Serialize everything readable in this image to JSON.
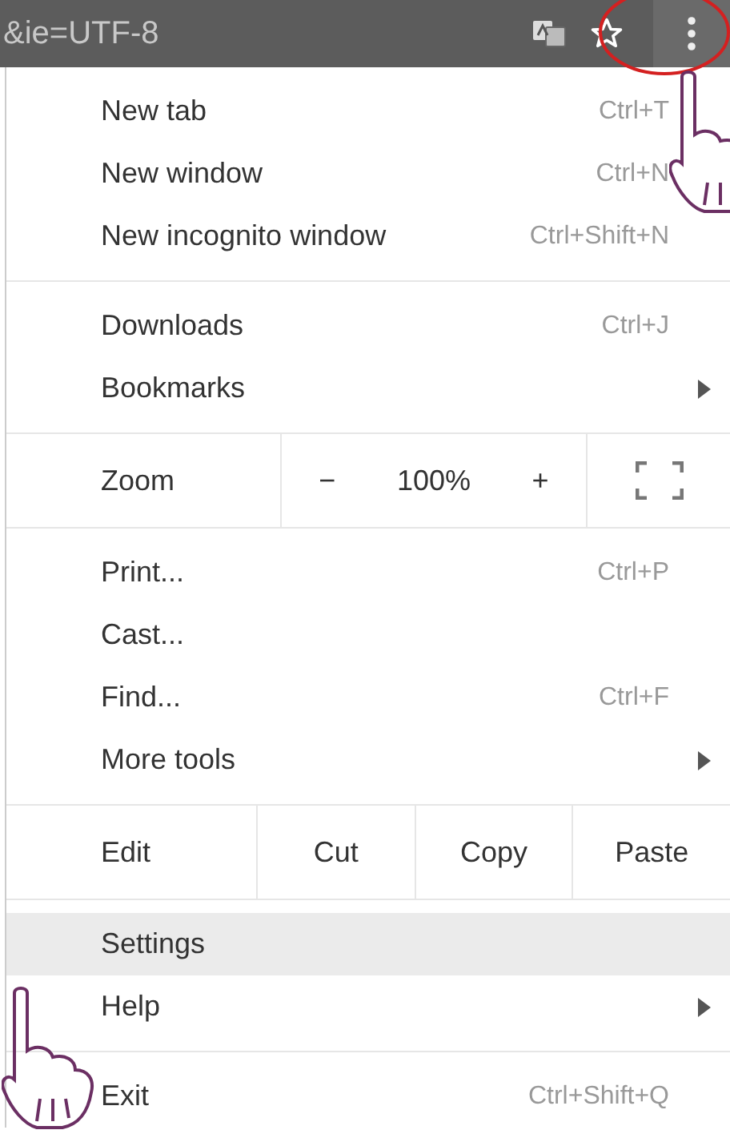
{
  "address_bar": {
    "url_text": "&ie=UTF-8"
  },
  "menu": {
    "sections": [
      {
        "kind": "items",
        "items": [
          {
            "label": "New tab",
            "shortcut": "Ctrl+T",
            "submenu": false,
            "selected": false
          },
          {
            "label": "New window",
            "shortcut": "Ctrl+N",
            "submenu": false,
            "selected": false
          },
          {
            "label": "New incognito window",
            "shortcut": "Ctrl+Shift+N",
            "submenu": false,
            "selected": false
          }
        ]
      },
      {
        "kind": "items",
        "items": [
          {
            "label": "Downloads",
            "shortcut": "Ctrl+J",
            "submenu": false,
            "selected": false
          },
          {
            "label": "Bookmarks",
            "submenu": true,
            "selected": false
          }
        ]
      },
      {
        "kind": "zoom",
        "label": "Zoom",
        "minus": "−",
        "value": "100%",
        "plus": "+"
      },
      {
        "kind": "items",
        "items": [
          {
            "label": "Print...",
            "shortcut": "Ctrl+P",
            "submenu": false,
            "selected": false
          },
          {
            "label": "Cast...",
            "submenu": false,
            "selected": false
          },
          {
            "label": "Find...",
            "shortcut": "Ctrl+F",
            "submenu": false,
            "selected": false
          },
          {
            "label": "More tools",
            "submenu": true,
            "selected": false
          }
        ]
      },
      {
        "kind": "edit",
        "label": "Edit",
        "buttons": [
          "Cut",
          "Copy",
          "Paste"
        ]
      },
      {
        "kind": "items",
        "items": [
          {
            "label": "Settings",
            "submenu": false,
            "selected": true
          },
          {
            "label": "Help",
            "submenu": true,
            "selected": false
          }
        ]
      },
      {
        "kind": "items",
        "items": [
          {
            "label": "Exit",
            "shortcut": "Ctrl+Shift+Q",
            "submenu": false,
            "selected": false
          }
        ]
      }
    ]
  }
}
